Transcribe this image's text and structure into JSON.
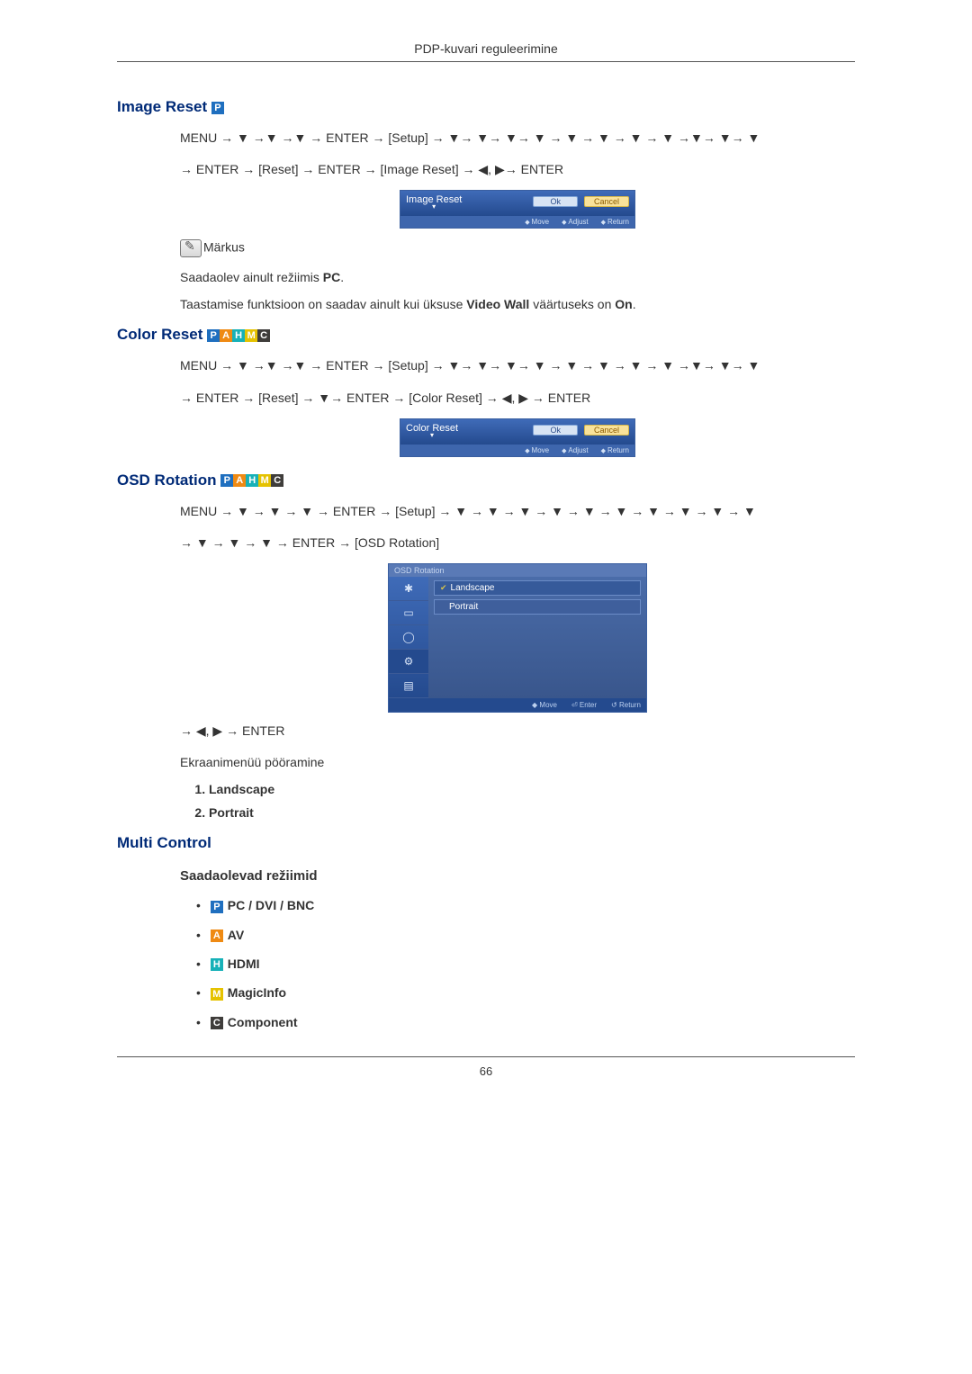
{
  "header": {
    "title": "PDP-kuvari reguleerimine"
  },
  "s1": {
    "title": "Image Reset",
    "badges": [
      "P"
    ],
    "path_line1": "MENU → ▼ →▼ →▼ → ENTER → [Setup] → ▼→ ▼→ ▼→ ▼ → ▼ → ▼ → ▼ → ▼ →▼→ ▼→ ▼",
    "path_line2": "→ ENTER → [Reset] → ENTER → [Image Reset] → ◀, ▶→ ENTER",
    "osd": {
      "title": "Image Reset",
      "ok": "Ok",
      "cancel": "Cancel",
      "foot_move": "Move",
      "foot_adjust": "Adjust",
      "foot_return": "Return"
    },
    "note_label": "Märkus",
    "note_p1_a": "Saadaolev ainult režiimis ",
    "note_p1_b": "PC",
    "note_p1_c": ".",
    "note_p2_a": "Taastamise funktsioon on saadav ainult kui üksuse ",
    "note_p2_b": "Video Wall",
    "note_p2_c": " väärtuseks on ",
    "note_p2_d": "On",
    "note_p2_e": "."
  },
  "s2": {
    "title": "Color Reset",
    "badges": [
      "P",
      "A",
      "H",
      "M",
      "C"
    ],
    "path_line1": "MENU → ▼ →▼ →▼ → ENTER → [Setup] → ▼→ ▼→ ▼→ ▼ → ▼ → ▼ → ▼ → ▼ →▼→ ▼→ ▼",
    "path_line2": "→ ENTER → [Reset] → ▼→ ENTER → [Color Reset] → ◀, ▶ → ENTER",
    "osd": {
      "title": "Color Reset",
      "ok": "Ok",
      "cancel": "Cancel",
      "foot_move": "Move",
      "foot_adjust": "Adjust",
      "foot_return": "Return"
    }
  },
  "s3": {
    "title": "OSD Rotation",
    "badges": [
      "P",
      "A",
      "H",
      "M",
      "C"
    ],
    "path_line1": "MENU → ▼ → ▼ → ▼ → ENTER → [Setup] → ▼ → ▼ → ▼ → ▼ → ▼ → ▼ → ▼ → ▼ → ▼ → ▼",
    "path_line2": "→ ▼ → ▼ → ▼ → ENTER → [OSD Rotation]",
    "osd": {
      "header": "OSD Rotation",
      "opt1": "Landscape",
      "opt2": "Portrait",
      "foot_move": "Move",
      "foot_enter": "Enter",
      "foot_return": "Return"
    },
    "after_line": "→ ◀, ▶ → ENTER",
    "desc": "Ekraanimenüü pööramine",
    "list": {
      "i1": "Landscape",
      "i2": "Portrait"
    }
  },
  "s4": {
    "title": "Multi Control",
    "subtitle": "Saadaolevad režiimid",
    "modes": {
      "m1": {
        "badge": "P",
        "label": "PC / DVI / BNC"
      },
      "m2": {
        "badge": "A",
        "label": "AV"
      },
      "m3": {
        "badge": "H",
        "label": "HDMI"
      },
      "m4": {
        "badge": "M",
        "label": "MagicInfo"
      },
      "m5": {
        "badge": "C",
        "label": "Component"
      }
    }
  },
  "page_number": "66"
}
